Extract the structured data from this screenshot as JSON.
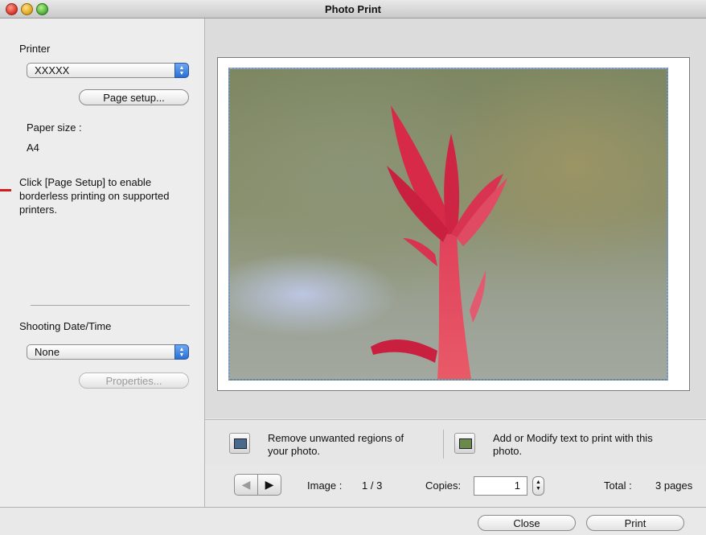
{
  "window": {
    "title": "Photo Print"
  },
  "sidebar": {
    "printer_label": "Printer",
    "printer_value": "XXXXX",
    "page_setup_label": "Page setup...",
    "paper_size_label": "Paper size :",
    "paper_size_value": "A4",
    "help_text": "Click [Page Setup] to enable borderless printing on supported printers.",
    "shooting_label": "Shooting Date/Time",
    "shooting_value": "None",
    "properties_label": "Properties..."
  },
  "tools": {
    "remove_label": "Remove unwanted regions of your photo.",
    "text_label": "Add or Modify text to print with this photo."
  },
  "navigation": {
    "image_label": "Image :",
    "image_value": "1 / 3",
    "copies_label": "Copies:",
    "copies_value": "1",
    "total_label": "Total :",
    "total_value": "3 pages"
  },
  "footer": {
    "close_label": "Close",
    "print_label": "Print"
  },
  "colors": {
    "accent_blue": "#2a6fd6",
    "selection_border": "#6b97d8",
    "red_marker": "#d31c1c",
    "flower": "#d8304c"
  }
}
